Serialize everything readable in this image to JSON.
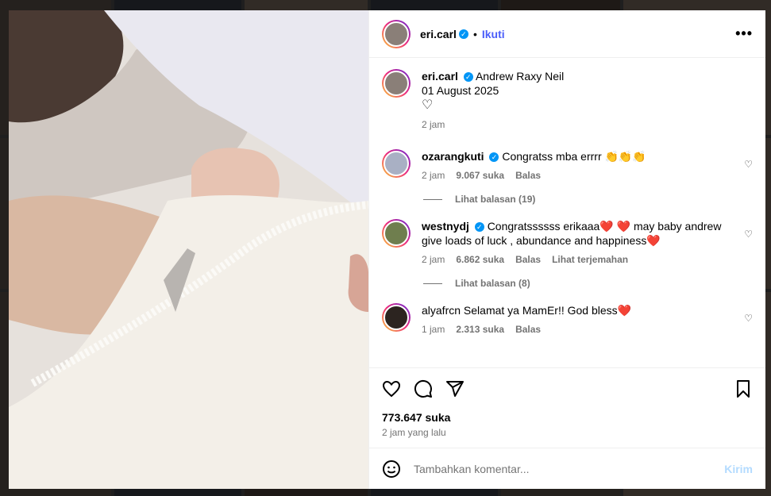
{
  "post": {
    "username": "eri.carl",
    "follow_label": "Ikuti",
    "dot": "•",
    "more_label": "•••",
    "caption": {
      "username": "eri.carl",
      "text_line1": "Andrew Raxy Neil",
      "text_line2": "01 August 2025",
      "time": "2 jam"
    }
  },
  "comments": [
    {
      "username": "ozarangkuti",
      "verified": true,
      "text": "Congratss mba errrr 👏👏👏",
      "time": "2 jam",
      "likes": "9.067 suka",
      "reply": "Balas",
      "translate": "",
      "view_replies": "Lihat balasan (19)"
    },
    {
      "username": "westnydj",
      "verified": true,
      "text": "Congratssssss erikaaa❤️ ❤️ may baby andrew give loads of luck , abundance and happiness❤️",
      "time": "2 jam",
      "likes": "6.862 suka",
      "reply": "Balas",
      "translate": "Lihat terjemahan",
      "view_replies": "Lihat balasan (8)"
    },
    {
      "username": "alyafrcn",
      "verified": false,
      "text": "Selamat ya MamEr!! God bless❤️",
      "time": "1 jam",
      "likes": "2.313 suka",
      "reply": "Balas",
      "translate": "",
      "view_replies": ""
    }
  ],
  "actions": {
    "likes": "773.647 suka",
    "posted": "2 jam yang lalu"
  },
  "add_comment": {
    "placeholder": "Tambahkan komentar...",
    "post_label": "Kirim"
  },
  "icons": [
    "heart-icon",
    "comment-icon",
    "share-icon",
    "bookmark-icon",
    "emoji-icon",
    "more-icon",
    "verified-icon"
  ],
  "colors": {
    "link": "#4a5df9",
    "verified": "#0095f6",
    "muted": "#737373",
    "post_disabled": "#b3dbff"
  }
}
